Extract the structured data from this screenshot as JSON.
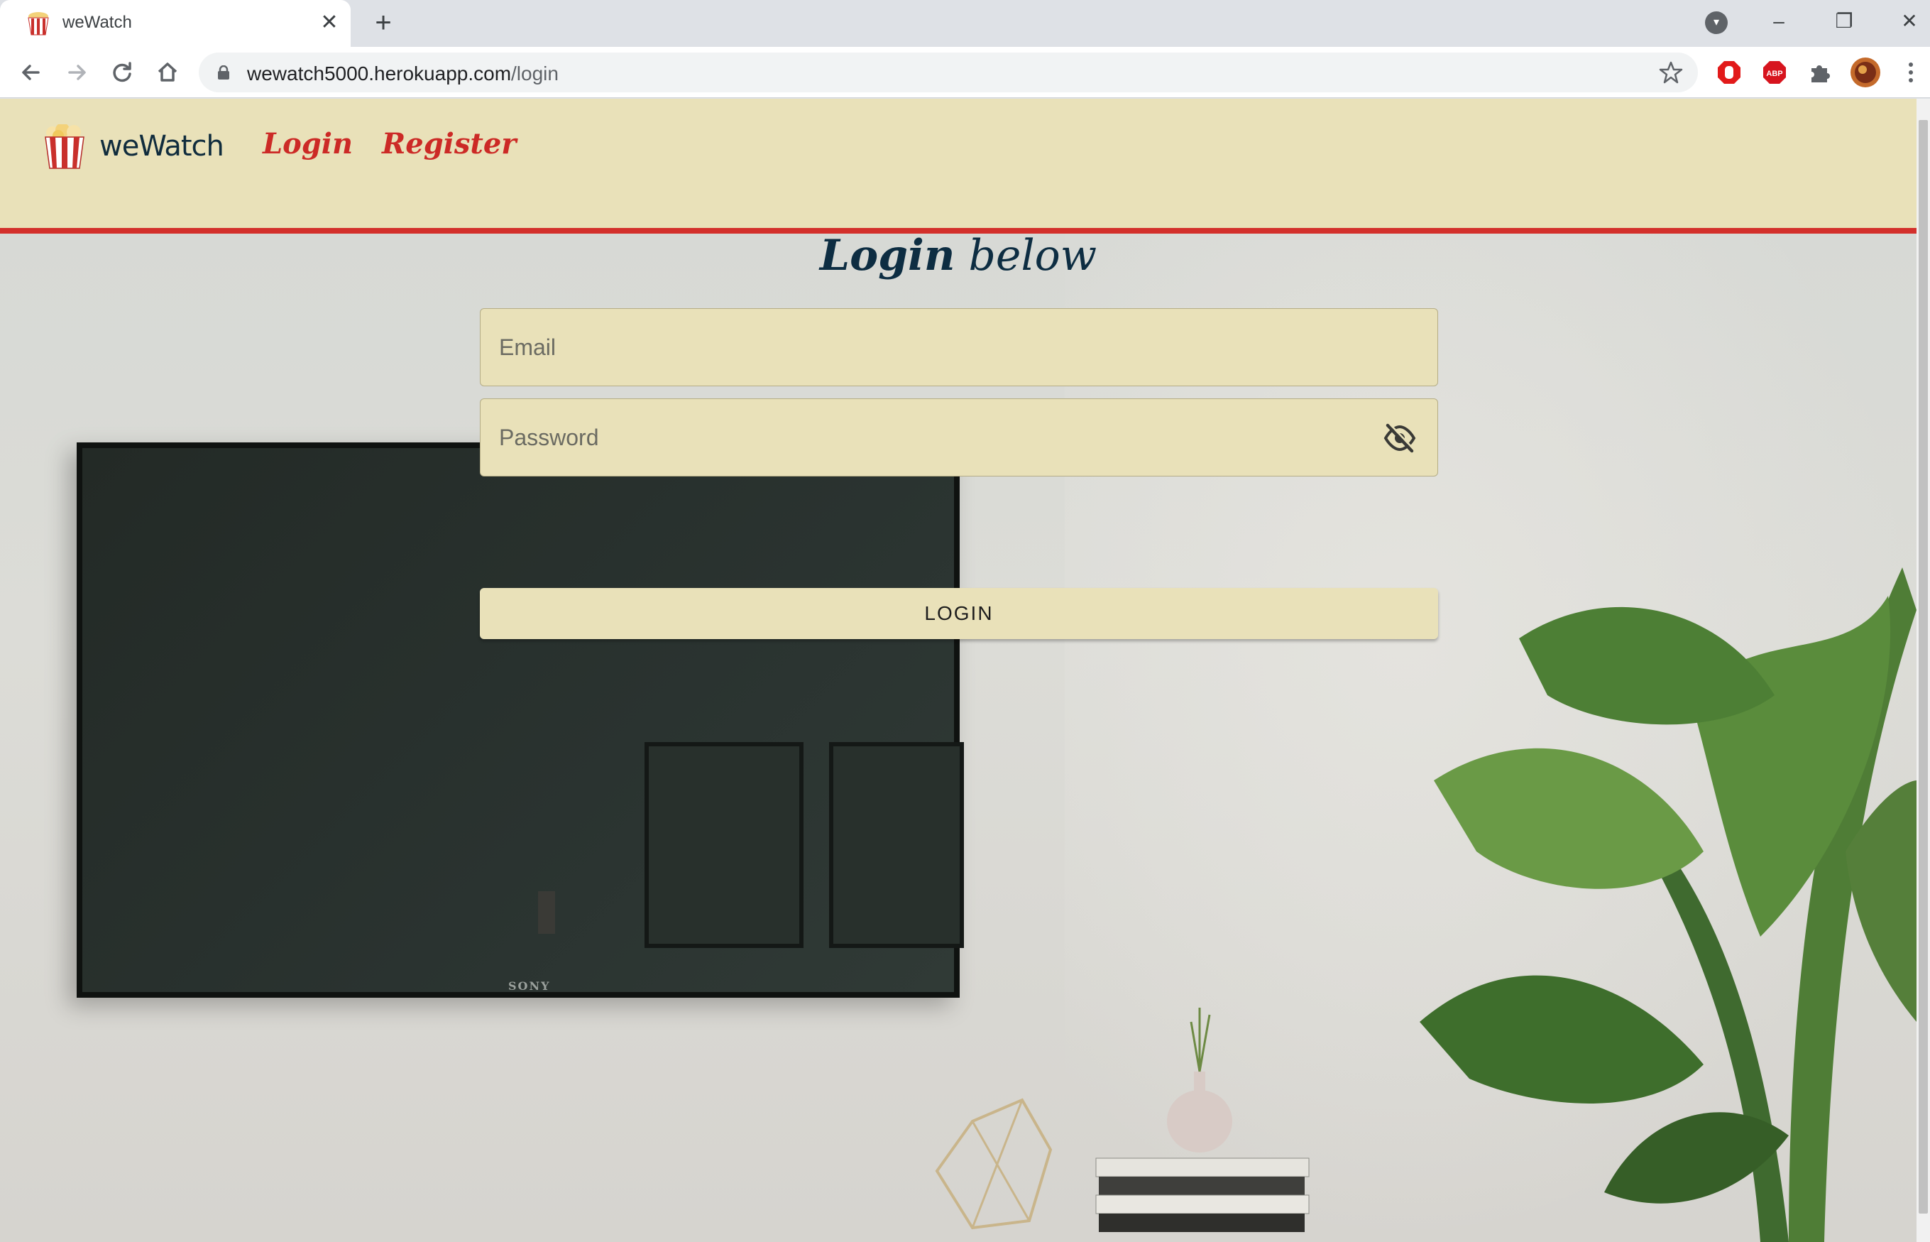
{
  "browser": {
    "tab_title": "weWatch",
    "tab_close": "✕",
    "new_tab": "+",
    "url_host": "wewatch5000.herokuapp.com",
    "url_path": "/login",
    "window_controls": {
      "minimize": "–",
      "restore": "❐",
      "close": "✕"
    },
    "extensions": [
      "opera-adblock-icon",
      "abp-icon",
      "puzzle-extensions-icon",
      "profile-avatar"
    ],
    "abp_label": "ABP"
  },
  "navbar": {
    "brand": "weWatch",
    "links": [
      {
        "label": "Login"
      },
      {
        "label": "Register"
      }
    ]
  },
  "form": {
    "title_bold": "Login",
    "title_rest": " below",
    "email_placeholder": "Email",
    "password_placeholder": "Password",
    "submit_label": "LOGIN"
  },
  "background": {
    "tv_brand": "SONY"
  },
  "colors": {
    "navbar_bg": "#e9e1b9",
    "accent_red": "#d3302b",
    "title_navy": "#0d2d42"
  }
}
